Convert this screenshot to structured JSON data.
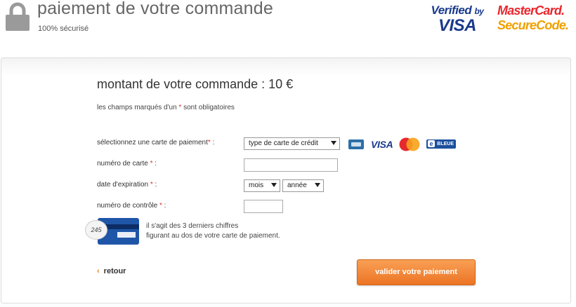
{
  "header": {
    "title": "paiement de votre commande",
    "subtitle": "100% sécurisé",
    "verified_by_line1": "Verified",
    "verified_by_by": "by",
    "verified_by_line2": "VISA",
    "mastercard_line1": "MasterCard.",
    "mastercard_line2": "SecureCode."
  },
  "form": {
    "amount_text": "montant de votre commande : 10 €",
    "required_note_prefix": "les champs marqués d'un",
    "required_note_star": "*",
    "required_note_suffix": "sont obligatoires",
    "card_type": {
      "label": "sélectionnez une carte de paiement",
      "selected": "type de carte de crédit"
    },
    "card_logos": [
      "cb-icon",
      "visa-icon",
      "mastercard-icon",
      "e-bleue-icon"
    ],
    "visa_text": "VISA",
    "ebleue_text": "BLEUE",
    "ebleue_e": "e",
    "card_number_label": "numéro de carte",
    "card_number_value": "",
    "expiry": {
      "label": "date d'expiration",
      "month_selected": "mois",
      "year_selected": "année"
    },
    "cvv": {
      "label": "numéro de contrôle",
      "value": "",
      "example": "245",
      "help_line1": "il s'agit des 3 derniers chiffres",
      "help_line2": "figurant au dos de votre carte de paiement."
    },
    "star": "*",
    "colon": ":",
    "back_label": "retour",
    "back_chevron": "‹",
    "submit_label": "valider votre paiement"
  },
  "colors": {
    "accent_orange": "#ec7424",
    "required_red": "#e03030",
    "visa_blue": "#1a3a8c"
  }
}
